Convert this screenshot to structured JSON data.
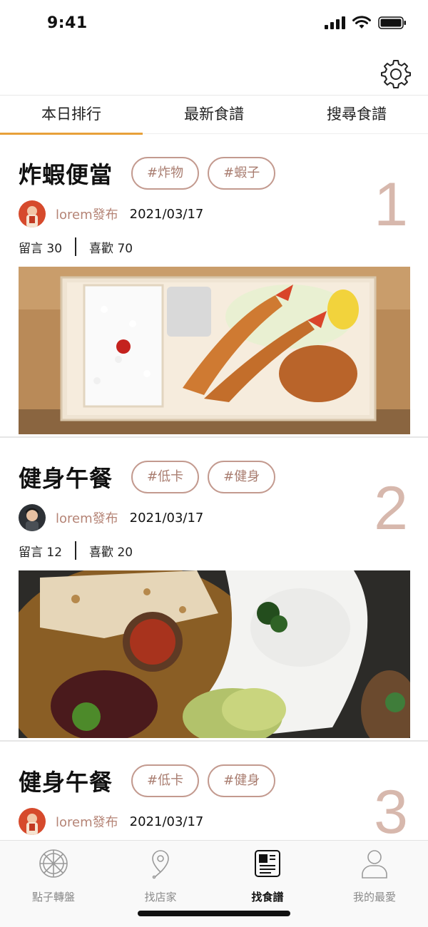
{
  "status_bar": {
    "time": "9:41"
  },
  "tabs": [
    {
      "label": "本日排行",
      "active": true
    },
    {
      "label": "最新食譜",
      "active": false
    },
    {
      "label": "搜尋食譜",
      "active": false
    }
  ],
  "recipes": [
    {
      "rank": "1",
      "title": "炸蝦便當",
      "tags": [
        "#炸物",
        "#蝦子"
      ],
      "author": "lorem發布",
      "date": "2021/03/17",
      "comments": "留言 30",
      "likes": "喜歡 70"
    },
    {
      "rank": "2",
      "title": "健身午餐",
      "tags": [
        "#低卡",
        "#健身"
      ],
      "author": "lorem發布",
      "date": "2021/03/17",
      "comments": "留言 12",
      "likes": "喜歡 20"
    },
    {
      "rank": "3",
      "title": "健身午餐",
      "tags": [
        "#低卡",
        "#健身"
      ],
      "author": "lorem發布",
      "date": "2021/03/17"
    }
  ],
  "bottom_nav": [
    {
      "label": "點子轉盤",
      "icon": "wheel-icon",
      "active": false
    },
    {
      "label": "找店家",
      "icon": "map-pin-icon",
      "active": false
    },
    {
      "label": "找食譜",
      "icon": "newspaper-icon",
      "active": true
    },
    {
      "label": "我的最愛",
      "icon": "person-icon",
      "active": false
    }
  ],
  "colors": {
    "accent": "#e8a13a",
    "tag_border": "#c39a8f",
    "rank_number": "#d7b8ad",
    "author_name": "#b58476"
  }
}
